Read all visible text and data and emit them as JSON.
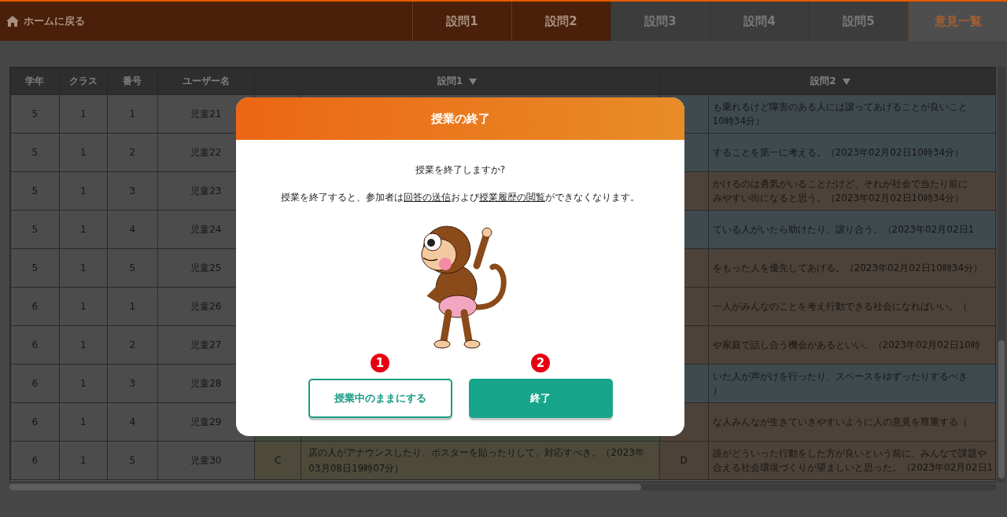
{
  "top_bar": {
    "home_link": "ホームに戻る",
    "tabs": [
      {
        "label": "設問1",
        "enabled": true,
        "selected": false
      },
      {
        "label": "設問2",
        "enabled": true,
        "selected": false
      },
      {
        "label": "設問3",
        "enabled": false,
        "selected": false
      },
      {
        "label": "設問4",
        "enabled": false,
        "selected": false
      },
      {
        "label": "設問5",
        "enabled": false,
        "selected": false
      },
      {
        "label": "意見一覧",
        "enabled": true,
        "selected": true
      }
    ]
  },
  "table": {
    "columns": [
      {
        "label": "学年",
        "sortable": false
      },
      {
        "label": "クラス",
        "sortable": false
      },
      {
        "label": "番号",
        "sortable": false
      },
      {
        "label": "ユーザー名",
        "sortable": false
      },
      {
        "label": "設問1",
        "sortable": true
      },
      {
        "label": "設問2",
        "sortable": true
      }
    ],
    "rows": [
      {
        "grade": "5",
        "class": "1",
        "number": "1",
        "user": "児童21",
        "q2": {
          "lines": [
            "も乗れるけど障害のある人には譲ってあげることが良いこと",
            "10時34分）"
          ],
          "color": "#3f4a4f"
        }
      },
      {
        "grade": "5",
        "class": "1",
        "number": "2",
        "user": "児童22",
        "q2": {
          "lines": [
            "することを第一に考える。（2023年02月02日10時34分）"
          ],
          "color": "#3f4a4f"
        }
      },
      {
        "grade": "5",
        "class": "1",
        "number": "3",
        "user": "児童23",
        "q2": {
          "lines": [
            "かけるのは勇気がいることだけど、それが社会で当たり前に",
            "みやすい街になると思う。（2023年02月02日10時34分）"
          ],
          "color": "#4d4239"
        }
      },
      {
        "grade": "5",
        "class": "1",
        "number": "4",
        "user": "児童24",
        "q2": {
          "lines": [
            "ている人がいたら助けたり、譲り合う。（2023年02月02日1"
          ],
          "color": "#3f4a4f"
        }
      },
      {
        "grade": "5",
        "class": "1",
        "number": "5",
        "user": "児童25",
        "q2": {
          "lines": [
            "をもった人を優先してあげる。（2023年02月02日10時34分）"
          ],
          "color": "#4d4239"
        }
      },
      {
        "grade": "6",
        "class": "1",
        "number": "1",
        "user": "児童26",
        "q2": {
          "lines": [
            "一人がみんなのことを考え行動できる社会になればいい。（"
          ],
          "color": "#4d4239"
        }
      },
      {
        "grade": "6",
        "class": "1",
        "number": "2",
        "user": "児童27",
        "q2": {
          "lines": [
            "や家庭で話し合う機会があるといい。（2023年02月02日10時"
          ],
          "color": "#4d4239"
        }
      },
      {
        "grade": "6",
        "class": "1",
        "number": "3",
        "user": "児童28",
        "q2": {
          "lines": [
            "いた人が声がけを行ったり、スペースをゆずったりするべき",
            "）"
          ],
          "color": "#3f4a4f"
        }
      },
      {
        "grade": "6",
        "class": "1",
        "number": "4",
        "user": "児童29",
        "q1": {
          "color": "#3f4a3a"
        },
        "q2": {
          "lines": [
            "な人みんなが生きていきやすいように人の意見を尊重する（"
          ],
          "color": "#4d4239"
        }
      },
      {
        "grade": "6",
        "class": "1",
        "number": "5",
        "user": "児童30",
        "q1": {
          "choice": "C",
          "lines": [
            "店の人がアナウンスしたり、ポスターを貼ったりして、対応すべき。（2023年03月08日19時07分）"
          ],
          "color": "#4d4a3a"
        },
        "q2": {
          "choice": "D",
          "lines": [
            "誰がどういった行動をした方が良いという前に、みんなで課題や",
            "合える社会環境づくりが望ましいと思った。（2023年02月02日1"
          ],
          "color": "#4d4239"
        }
      }
    ]
  },
  "dialog": {
    "title": "授業の終了",
    "question": "授業を終了しますか?",
    "message": [
      {
        "text": "授業を終了すると、参加者は",
        "underline": false
      },
      {
        "text": "回答の送信",
        "underline": true
      },
      {
        "text": "および",
        "underline": false
      },
      {
        "text": "授業履歴の閲覧",
        "underline": true
      },
      {
        "text": "ができなくなります。",
        "underline": false
      }
    ],
    "buttons": [
      {
        "label": "授業中のままにする",
        "kind": "outline",
        "step": "1"
      },
      {
        "label": "終了",
        "kind": "primary",
        "step": "2"
      }
    ]
  }
}
